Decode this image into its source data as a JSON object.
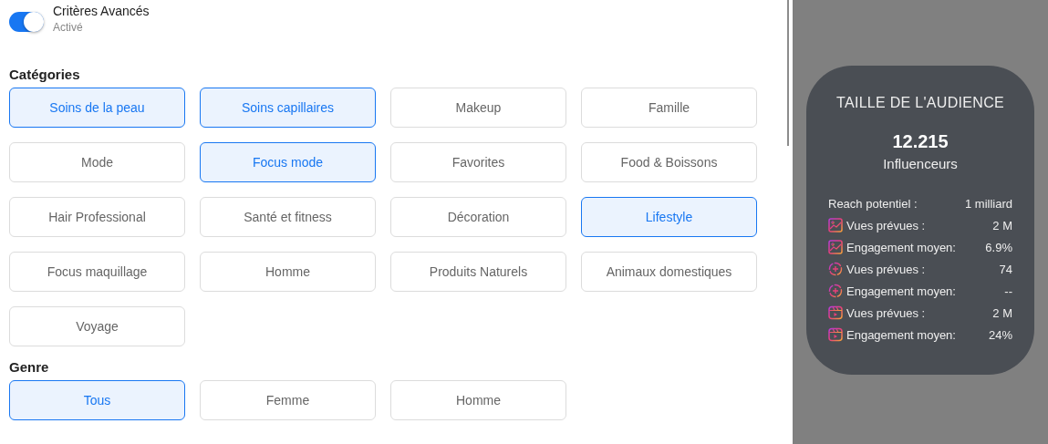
{
  "toggle": {
    "label": "Critères Avancés",
    "status": "Activé",
    "on": true
  },
  "categories": {
    "title": "Catégories",
    "options": [
      {
        "label": "Soins de la peau",
        "selected": true
      },
      {
        "label": "Soins capillaires",
        "selected": true
      },
      {
        "label": "Makeup",
        "selected": false
      },
      {
        "label": "Famille",
        "selected": false
      },
      {
        "label": "Mode",
        "selected": false
      },
      {
        "label": "Focus mode",
        "selected": true
      },
      {
        "label": "Favorites",
        "selected": false
      },
      {
        "label": "Food & Boissons",
        "selected": false
      },
      {
        "label": "Hair Professional",
        "selected": false
      },
      {
        "label": "Santé et fitness",
        "selected": false
      },
      {
        "label": "Décoration",
        "selected": false
      },
      {
        "label": "Lifestyle",
        "selected": true
      },
      {
        "label": "Focus maquillage",
        "selected": false
      },
      {
        "label": "Homme",
        "selected": false
      },
      {
        "label": "Produits Naturels",
        "selected": false
      },
      {
        "label": "Animaux domestiques",
        "selected": false
      },
      {
        "label": "Voyage",
        "selected": false
      }
    ]
  },
  "genre": {
    "title": "Genre",
    "options": [
      {
        "label": "Tous",
        "selected": true
      },
      {
        "label": "Femme",
        "selected": false
      },
      {
        "label": "Homme",
        "selected": false
      }
    ]
  },
  "audience": {
    "title": "TAILLE DE L'AUDIENCE",
    "count": "12.215",
    "unit": "Influenceurs",
    "stats": [
      {
        "kind": "plain",
        "label": "Reach potentiel :",
        "value": "1 milliard"
      },
      {
        "kind": "post",
        "label": "Vues prévues :",
        "value": "2 M"
      },
      {
        "kind": "post",
        "label": "Engagement moyen:",
        "value": "6.9%"
      },
      {
        "kind": "plus",
        "label": "Vues prévues :",
        "value": "74"
      },
      {
        "kind": "plus",
        "label": "Engagement moyen:",
        "value": "--"
      },
      {
        "kind": "reel",
        "label": "Vues prévues :",
        "value": "2 M"
      },
      {
        "kind": "reel",
        "label": "Engagement moyen:",
        "value": "24%"
      }
    ]
  }
}
